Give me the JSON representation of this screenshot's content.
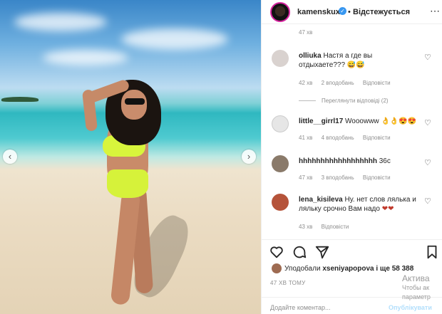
{
  "post": {
    "username": "kamenskux",
    "dot": "•",
    "follow_label": "Відстежується",
    "more_icon": "⋯"
  },
  "comments": {
    "top_time": "47 хв",
    "items": [
      {
        "user": "olliuka",
        "text": "Настя а где вы отдыхаете???",
        "emoji": "😅😅",
        "time": "42 хв",
        "likes": "2 вподобань",
        "reply": "Відповісти",
        "replies_label": "Переглянути відповіді (2)"
      },
      {
        "user": "little__girrl17",
        "text": "Wooowww",
        "emoji": "👌👌😍😍",
        "time": "41 хв",
        "likes": "4 вподобань",
        "reply": "Відповісти"
      },
      {
        "user": "hhhhhhhhhhhhhhhhhh",
        "text": "36с",
        "emoji": "",
        "time": "47 хв",
        "likes": "3 вподобань",
        "reply": "Відповісти"
      },
      {
        "user": "lena_kisileva",
        "text": "Ну. нет слов лялька и ляльку срочно Вам надо",
        "emoji": "❤❤",
        "time": "43 хв",
        "likes": "",
        "reply": "Відповісти"
      }
    ]
  },
  "likes": {
    "prefix": "Уподобали",
    "user": "xseniyapopova",
    "suffix": "і ще 58 388"
  },
  "date": "47 ХВ ТОМУ",
  "add_comment": {
    "placeholder": "Додайте коментар...",
    "publish": "Опублікувати"
  },
  "watermark": {
    "line1": "Актива",
    "line2": "Чтобы ак",
    "line3": "параметр"
  },
  "colors": {
    "accent": "#3897f0",
    "text": "#262626",
    "muted": "#8e8e8e",
    "bikini": "#d8f53c"
  }
}
